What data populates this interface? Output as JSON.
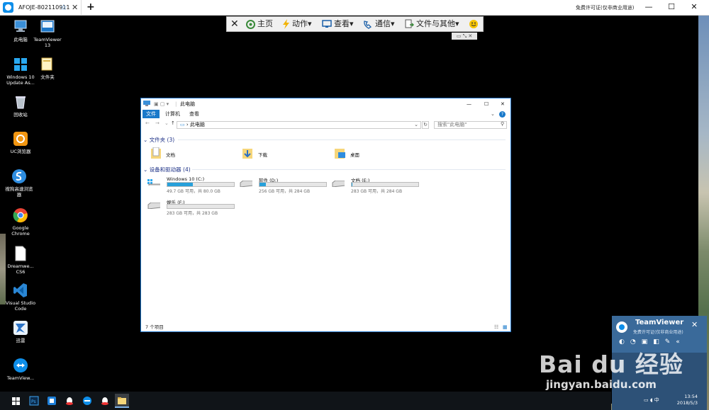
{
  "teamviewer": {
    "tab_label": "AFOJE-802110911",
    "new_tab": "+",
    "license": "免费许可证(仅非商业用途)",
    "minimize": "—",
    "maximize": "☐",
    "close": "✕"
  },
  "toolbar": {
    "close": "✕",
    "home": "主页",
    "actions": "动作",
    "view": "查看",
    "communicate": "通信",
    "files": "文件与其他",
    "caret": "▾"
  },
  "desktop": {
    "icons": [
      {
        "label": "此电脑"
      },
      {
        "label": "TeamViewer 13"
      },
      {
        "label": "Windows 10 Update As..."
      },
      {
        "label": "文件夹"
      },
      {
        "label": "回收站"
      },
      {
        "label": "UC浏览器"
      },
      {
        "label": "搜狗高速浏览器"
      },
      {
        "label": "Google Chrome"
      },
      {
        "label": "Dreamwe... CS6"
      },
      {
        "label": "Visual Studio Code"
      },
      {
        "label": "迅雷"
      },
      {
        "label": "TeamView..."
      }
    ]
  },
  "explorer": {
    "title": "此电脑",
    "minimize": "—",
    "maximize": "☐",
    "close": "✕",
    "ribbon": {
      "file": "文件",
      "computer": "计算机",
      "view": "查看"
    },
    "address": "此电脑",
    "search_placeholder": "搜索\"此电脑\"",
    "folders_header": "文件夹 (3)",
    "folders": [
      {
        "name": "文档"
      },
      {
        "name": "下载"
      },
      {
        "name": "桌面"
      }
    ],
    "drives_header": "设备和驱动器 (4)",
    "drives": [
      {
        "name": "Windows 10 (C:)",
        "info": "49.7 GB 可用，共 80.0 GB",
        "used": 0.38
      },
      {
        "name": "软件 (D:)",
        "info": "256 GB 可用，共 284 GB",
        "used": 0.1
      },
      {
        "name": "文档 (E:)",
        "info": "283 GB 可用，共 284 GB",
        "used": 0.004
      },
      {
        "name": "娱乐 (F:)",
        "info": "283 GB 可用，共 283 GB",
        "used": 0.0
      }
    ],
    "status": "7 个项目"
  },
  "tv_panel": {
    "name": "TeamViewer",
    "license": "免费许可证(仅非商业用途)",
    "close": "✕"
  },
  "clock": {
    "time": "13:54",
    "date": "2018/5/3",
    "ime": "中"
  },
  "watermark": {
    "brand": "Bai du 经验",
    "url": "jingyan.baidu.com"
  }
}
